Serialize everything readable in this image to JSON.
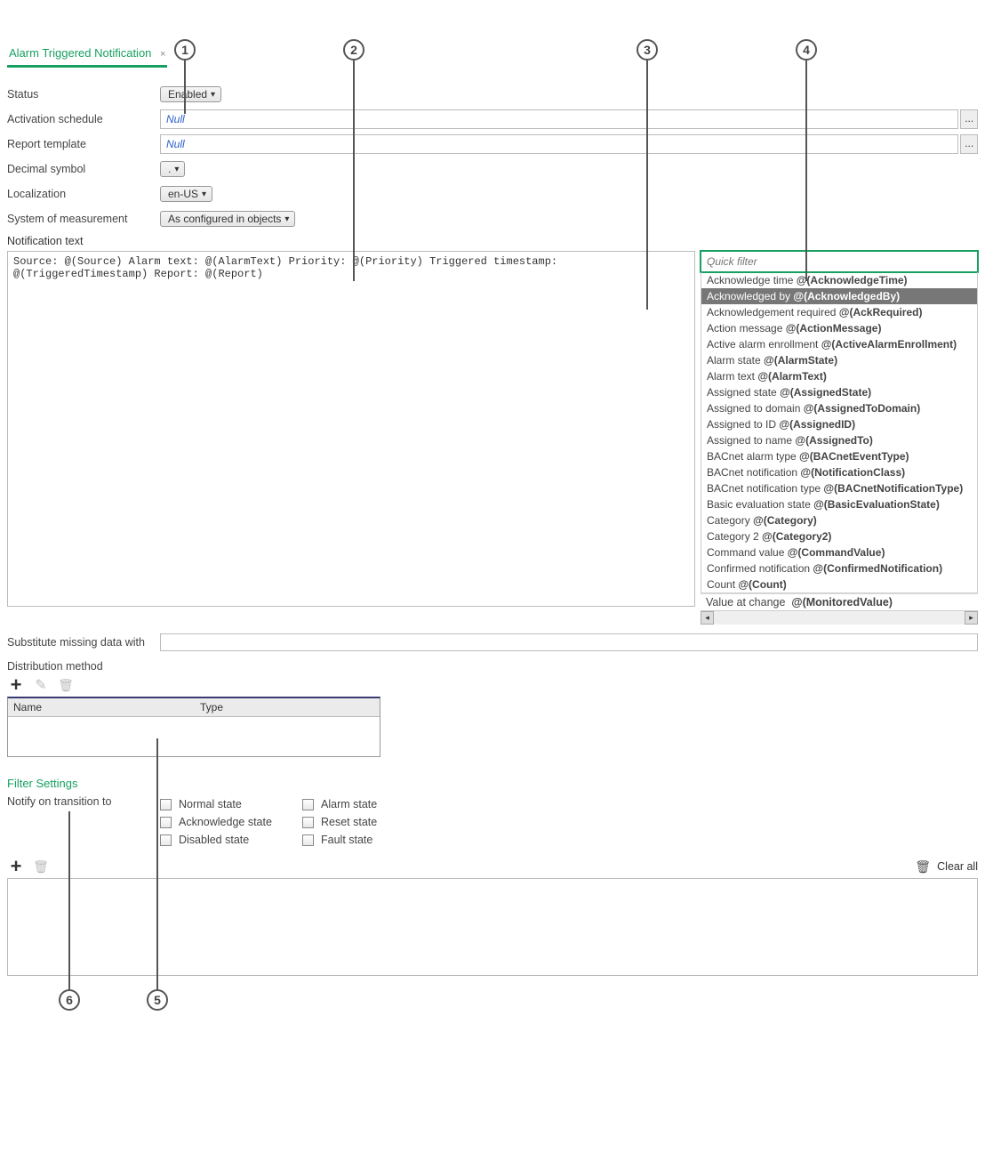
{
  "callouts": [
    "1",
    "2",
    "3",
    "4",
    "5",
    "6"
  ],
  "tab": {
    "title": "Alarm Triggered Notification",
    "close": "×"
  },
  "form": {
    "status_label": "Status",
    "status_value": "Enabled",
    "activation_label": "Activation schedule",
    "activation_value": "Null",
    "report_label": "Report template",
    "report_value": "Null",
    "decimal_label": "Decimal symbol",
    "decimal_value": ".",
    "localization_label": "Localization",
    "localization_value": "en-US",
    "som_label": "System of measurement",
    "som_value": "As configured in objects",
    "notif_label": "Notification text",
    "notif_text": "Source: @(Source) Alarm text: @(AlarmText) Priority: @(Priority) Triggered timestamp: @(TriggeredTimestamp) Report: @(Report)",
    "quick_filter_placeholder": "Quick filter",
    "substitutions": [
      {
        "label": "Acknowledge time",
        "token": "@(AcknowledgeTime)",
        "sel": false
      },
      {
        "label": "Acknowledged by",
        "token": "@(AcknowledgedBy)",
        "sel": true
      },
      {
        "label": "Acknowledgement required",
        "token": "@(AckRequired)",
        "sel": false
      },
      {
        "label": "Action message",
        "token": "@(ActionMessage)",
        "sel": false
      },
      {
        "label": "Active alarm enrollment",
        "token": "@(ActiveAlarmEnrollment)",
        "sel": false
      },
      {
        "label": "Alarm state",
        "token": "@(AlarmState)",
        "sel": false
      },
      {
        "label": "Alarm text",
        "token": "@(AlarmText)",
        "sel": false
      },
      {
        "label": "Assigned state",
        "token": "@(AssignedState)",
        "sel": false
      },
      {
        "label": "Assigned to domain",
        "token": "@(AssignedToDomain)",
        "sel": false
      },
      {
        "label": "Assigned to ID",
        "token": "@(AssignedID)",
        "sel": false
      },
      {
        "label": "Assigned to name",
        "token": "@(AssignedTo)",
        "sel": false
      },
      {
        "label": "BACnet alarm type",
        "token": "@(BACnetEventType)",
        "sel": false
      },
      {
        "label": "BACnet notification",
        "token": "@(NotificationClass)",
        "sel": false
      },
      {
        "label": "BACnet notification type",
        "token": "@(BACnetNotificationType)",
        "sel": false
      },
      {
        "label": "Basic evaluation state",
        "token": "@(BasicEvaluationState)",
        "sel": false
      },
      {
        "label": "Category",
        "token": "@(Category)",
        "sel": false
      },
      {
        "label": "Category 2",
        "token": "@(Category2)",
        "sel": false
      },
      {
        "label": "Command value",
        "token": "@(CommandValue)",
        "sel": false
      },
      {
        "label": "Confirmed notification",
        "token": "@(ConfirmedNotification)",
        "sel": false
      },
      {
        "label": "Count",
        "token": "@(Count)",
        "sel": false
      }
    ],
    "fixed_sub": {
      "label": "Value at change",
      "token": "@(MonitoredValue)"
    },
    "missing_label": "Substitute missing data with",
    "missing_value": "",
    "dist_label": "Distribution method",
    "dist_cols": {
      "name": "Name",
      "type": "Type"
    },
    "ellipsis": "..."
  },
  "filter": {
    "heading": "Filter Settings",
    "lead": "Notify on transition to",
    "c1": [
      "Normal state",
      "Acknowledge state",
      "Disabled state"
    ],
    "c2": [
      "Alarm state",
      "Reset state",
      "Fault state"
    ],
    "clear_all": "Clear all"
  }
}
